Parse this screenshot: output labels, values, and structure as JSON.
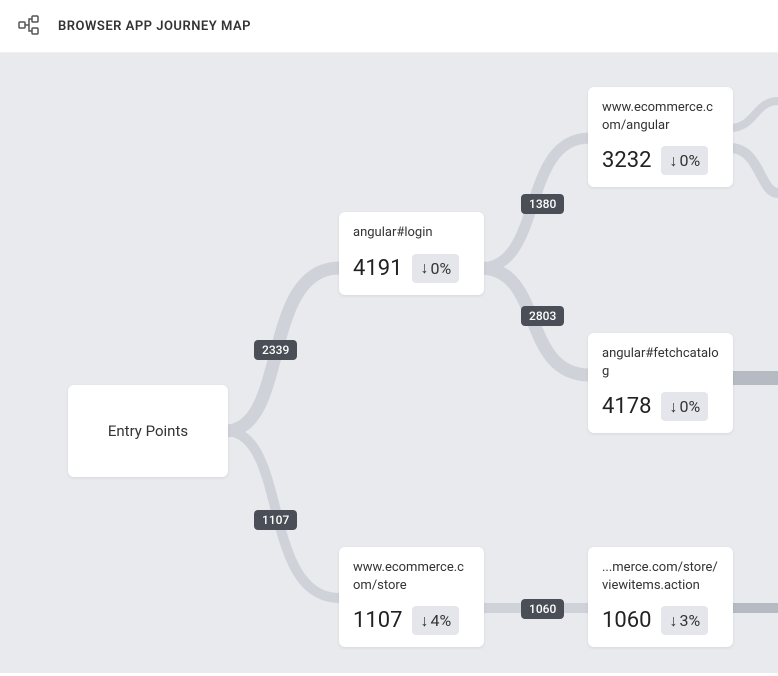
{
  "header": {
    "title": "BROWSER APP JOURNEY MAP"
  },
  "entry": {
    "label": "Entry Points"
  },
  "nodes": {
    "login": {
      "label": "angular#login",
      "count": "4191",
      "pct": "0%"
    },
    "store": {
      "label": "www.ecommerce.com/store",
      "count": "1107",
      "pct": "4%"
    },
    "angular": {
      "label": "www.ecommerce.com/angular",
      "count": "3232",
      "pct": "0%"
    },
    "fetch": {
      "label": "angular#fetchcatalog",
      "count": "4178",
      "pct": "0%"
    },
    "viewitems": {
      "label": "...merce.com/store/viewitems.action",
      "count": "1060",
      "pct": "3%"
    }
  },
  "edges": {
    "e1": "2339",
    "e2": "1107",
    "e3": "1380",
    "e4": "2803",
    "e5": "1060"
  }
}
